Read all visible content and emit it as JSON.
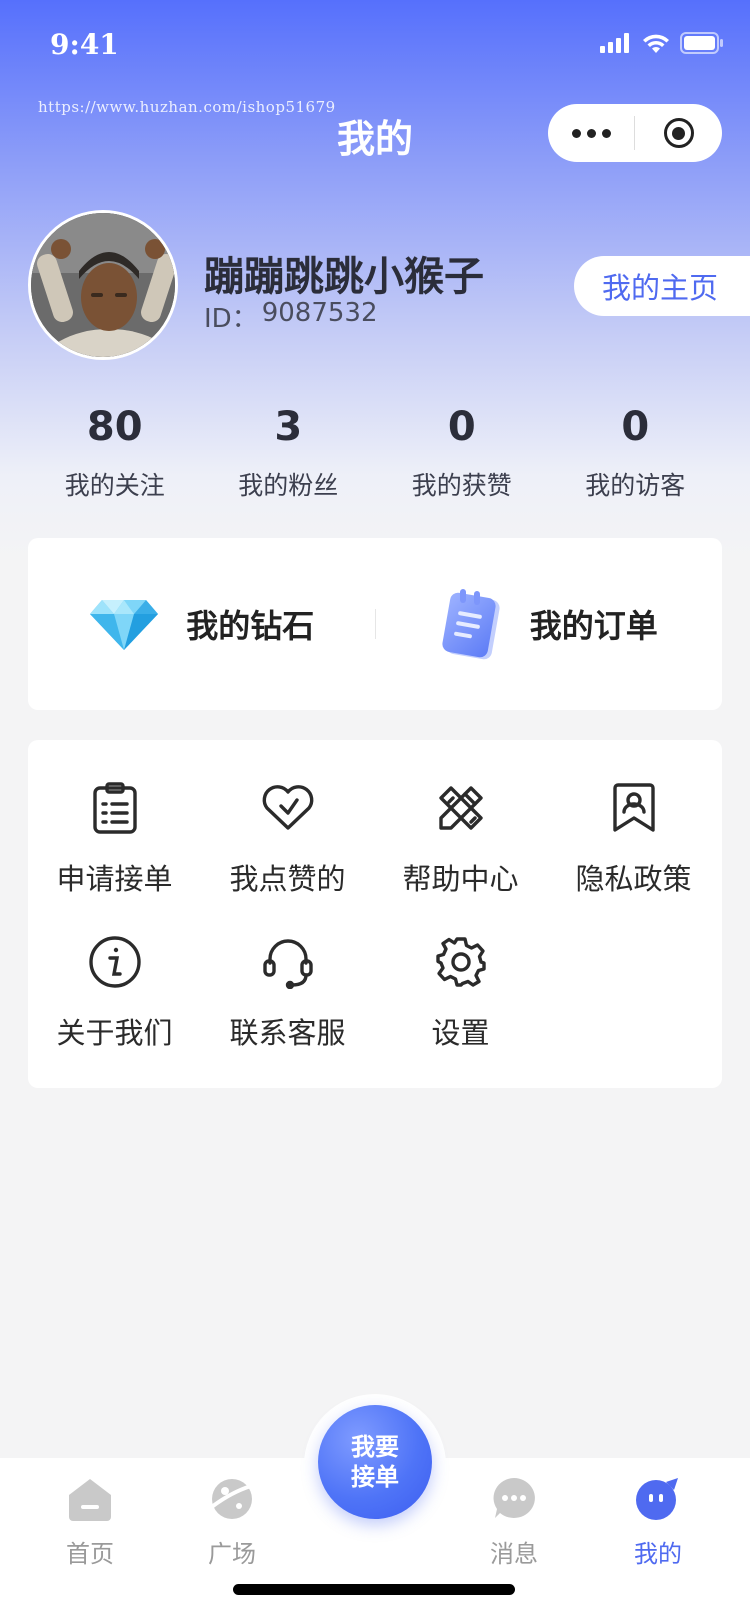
{
  "status_bar": {
    "time": "9:41"
  },
  "watermark": "https://www.huzhan.com/ishop51679",
  "nav": {
    "title": "我的"
  },
  "profile": {
    "username": "蹦蹦跳跳小猴子",
    "id_label": "ID：",
    "id_value": "9087532",
    "home_button": "我的主页"
  },
  "stats": [
    {
      "value": "80",
      "label": "我的关注"
    },
    {
      "value": "3",
      "label": "我的粉丝"
    },
    {
      "value": "0",
      "label": "我的获赞"
    },
    {
      "value": "0",
      "label": "我的访客"
    }
  ],
  "quick": [
    {
      "label": "我的钻石",
      "icon": "diamond-icon"
    },
    {
      "label": "我的订单",
      "icon": "notepad-icon"
    }
  ],
  "menu": [
    {
      "label": "申请接单",
      "icon": "clipboard-icon"
    },
    {
      "label": "我点赞的",
      "icon": "heart-icon"
    },
    {
      "label": "帮助中心",
      "icon": "pencil-ruler-icon"
    },
    {
      "label": "隐私政策",
      "icon": "bookmark-icon"
    },
    {
      "label": "关于我们",
      "icon": "info-icon"
    },
    {
      "label": "联系客服",
      "icon": "headset-icon"
    },
    {
      "label": "设置",
      "icon": "gear-icon"
    }
  ],
  "tabbar": {
    "tabs": [
      {
        "label": "首页",
        "icon": "home-icon",
        "active": false
      },
      {
        "label": "广场",
        "icon": "planet-icon",
        "active": false
      },
      {
        "label": "消息",
        "icon": "chat-icon",
        "active": false
      },
      {
        "label": "我的",
        "icon": "profile-icon",
        "active": true
      }
    ],
    "center_button": {
      "line1": "我要",
      "line2": "接单"
    }
  },
  "colors": {
    "accent": "#4f6af0",
    "header_top": "#5670fc",
    "inactive": "#9a9a9a"
  }
}
